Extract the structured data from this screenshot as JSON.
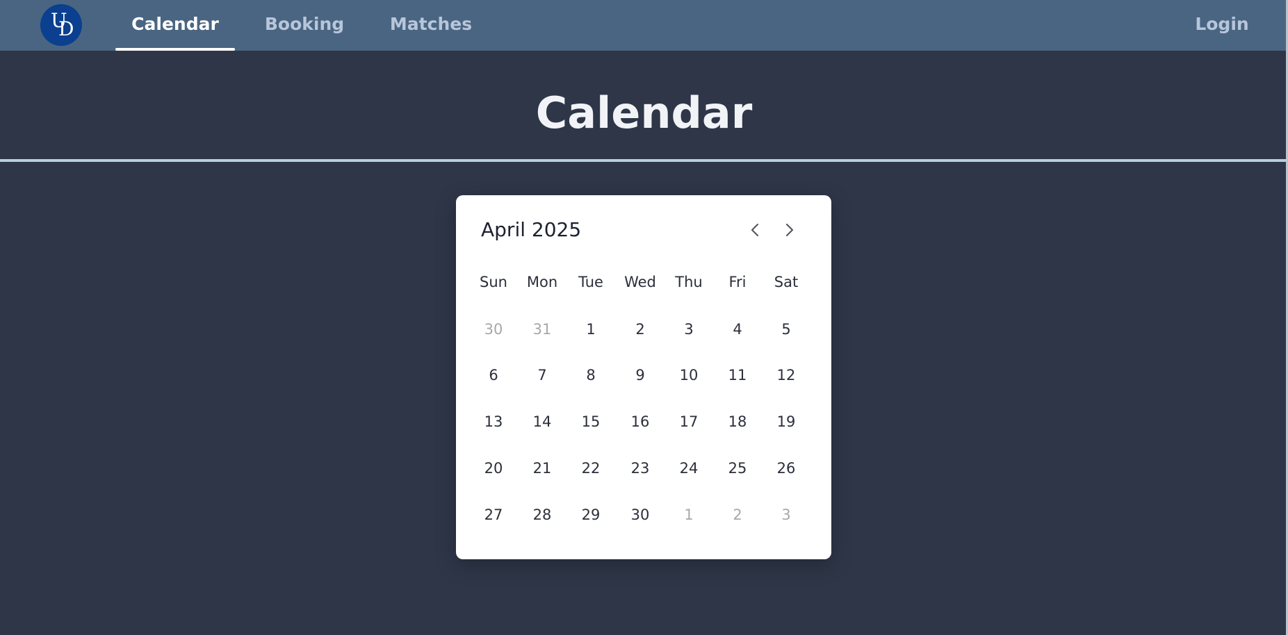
{
  "nav": {
    "logo": {
      "letter1": "U",
      "letter2": "D"
    },
    "links": [
      {
        "label": "Calendar",
        "active": true
      },
      {
        "label": "Booking",
        "active": false
      },
      {
        "label": "Matches",
        "active": false
      }
    ],
    "login_label": "Login"
  },
  "page": {
    "title": "Calendar"
  },
  "calendar": {
    "month_label": "April 2025",
    "prev_icon": "chevron-left-icon",
    "next_icon": "chevron-right-icon",
    "weekdays": [
      "Sun",
      "Mon",
      "Tue",
      "Wed",
      "Thu",
      "Fri",
      "Sat"
    ],
    "weeks": [
      [
        {
          "d": "30",
          "muted": true
        },
        {
          "d": "31",
          "muted": true
        },
        {
          "d": "1"
        },
        {
          "d": "2"
        },
        {
          "d": "3"
        },
        {
          "d": "4"
        },
        {
          "d": "5"
        }
      ],
      [
        {
          "d": "6"
        },
        {
          "d": "7"
        },
        {
          "d": "8"
        },
        {
          "d": "9"
        },
        {
          "d": "10"
        },
        {
          "d": "11"
        },
        {
          "d": "12"
        }
      ],
      [
        {
          "d": "13"
        },
        {
          "d": "14"
        },
        {
          "d": "15"
        },
        {
          "d": "16"
        },
        {
          "d": "17"
        },
        {
          "d": "18"
        },
        {
          "d": "19"
        }
      ],
      [
        {
          "d": "20"
        },
        {
          "d": "21"
        },
        {
          "d": "22"
        },
        {
          "d": "23"
        },
        {
          "d": "24"
        },
        {
          "d": "25"
        },
        {
          "d": "26"
        }
      ],
      [
        {
          "d": "27"
        },
        {
          "d": "28"
        },
        {
          "d": "29"
        },
        {
          "d": "30"
        },
        {
          "d": "1",
          "muted": true
        },
        {
          "d": "2",
          "muted": true
        },
        {
          "d": "3",
          "muted": true
        }
      ]
    ]
  },
  "colors": {
    "navbar": "#4a6582",
    "background": "#2e3648",
    "logo": "#0b3f8f",
    "divider": "#b8cfe0",
    "muted_day": "#a7a7ad"
  }
}
